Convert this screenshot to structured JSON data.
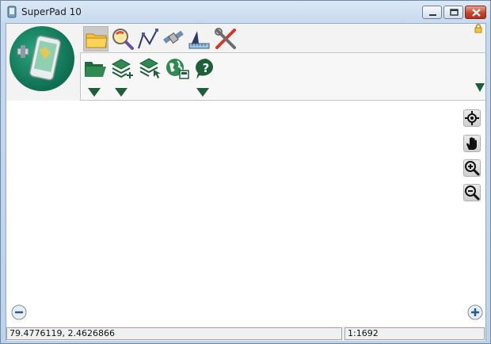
{
  "window": {
    "title": "SuperPad 10"
  },
  "toolbar": {
    "tabs": [
      {
        "name": "folder-icon",
        "active": true
      },
      {
        "name": "search-icon",
        "active": false
      },
      {
        "name": "draw-icon",
        "active": false
      },
      {
        "name": "satellite-icon",
        "active": false
      },
      {
        "name": "measure-icon",
        "active": false
      },
      {
        "name": "tools-icon",
        "active": false
      }
    ],
    "lock_icon": "lock-icon"
  },
  "ribbon": {
    "buttons": [
      {
        "name": "open-folder-icon"
      },
      {
        "name": "add-layer-icon"
      },
      {
        "name": "layer-select-icon"
      },
      {
        "name": "globe-export-icon"
      },
      {
        "name": "help-icon"
      }
    ]
  },
  "map_tools": [
    "locate-icon",
    "pan-hand-icon",
    "zoom-in-icon",
    "zoom-out-icon"
  ],
  "status": {
    "coordinates": "79.4776119, 2.4626866",
    "scale": "1:1692"
  },
  "colors": {
    "accent_green": "#1d5f38",
    "logo_green": "#0f7153"
  }
}
